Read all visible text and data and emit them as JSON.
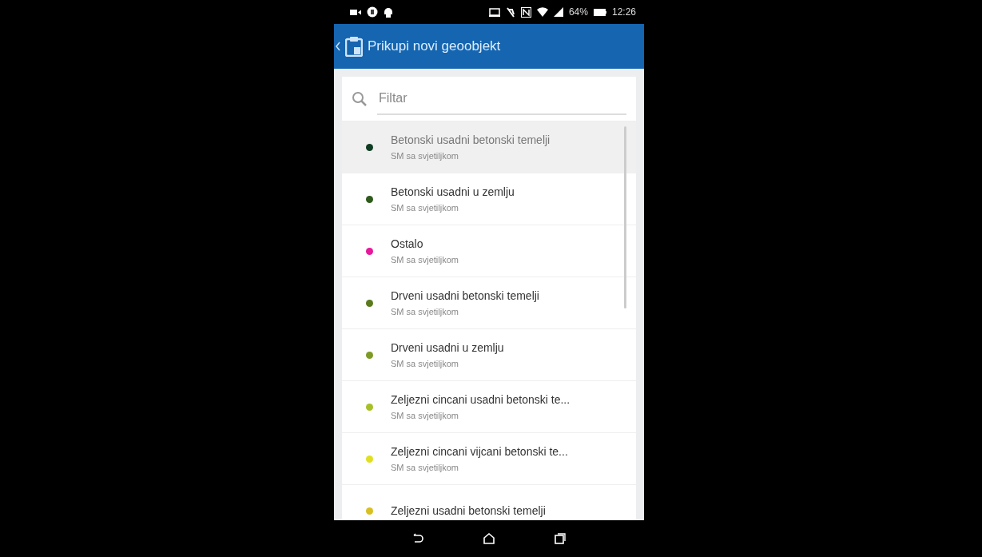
{
  "status_bar": {
    "battery": "64%",
    "time": "12:26"
  },
  "app_bar": {
    "title": "Prikupi novi geoobjekt"
  },
  "filter": {
    "placeholder": "Filtar"
  },
  "items": [
    {
      "title": "Betonski usadni betonski temelji",
      "subtitle": "SM sa svjetiljkom",
      "color": "#0f3d22",
      "selected": true
    },
    {
      "title": "Betonski usadni u zemlju",
      "subtitle": "SM sa svjetiljkom",
      "color": "#2e5a1c",
      "selected": false
    },
    {
      "title": "Ostalo",
      "subtitle": "SM sa svjetiljkom",
      "color": "#e8189c",
      "selected": false
    },
    {
      "title": "Drveni usadni betonski temelji",
      "subtitle": "SM sa svjetiljkom",
      "color": "#5a7a1e",
      "selected": false
    },
    {
      "title": "Drveni usadni u zemlju",
      "subtitle": "SM sa svjetiljkom",
      "color": "#7d9a26",
      "selected": false
    },
    {
      "title": "Zeljezni cincani usadni betonski te...",
      "subtitle": "SM sa svjetiljkom",
      "color": "#a8c028",
      "selected": false
    },
    {
      "title": "Zeljezni cincani vijcani betonski te...",
      "subtitle": "SM sa svjetiljkom",
      "color": "#e0e020",
      "selected": false
    },
    {
      "title": "Zeljezni usadni betonski temelji",
      "color": "#d8c020",
      "selected": false
    }
  ]
}
